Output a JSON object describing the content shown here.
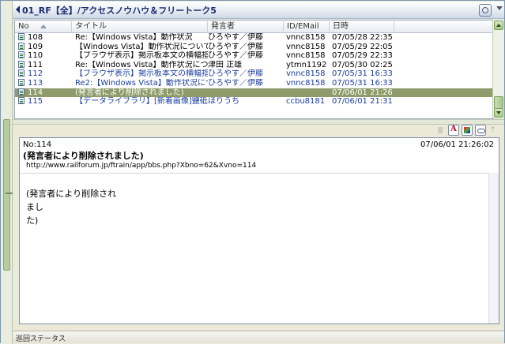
{
  "window": {
    "title": "01_RF【全】/アクセスノウハウ＆フリートーク5"
  },
  "list": {
    "columns": [
      "No",
      "タイトル",
      "発言者",
      "ID/EMail",
      "日時"
    ],
    "rows": [
      {
        "no": "108",
        "title": "Re:【Windows Vista】動作状況",
        "poster": "ひろやす／伊藤",
        "id": "vnnc8158",
        "date": "07/05/28 22:35...",
        "style": "normal"
      },
      {
        "no": "109",
        "title": "【Windows Vista】動作状況についての...",
        "poster": "ひろやす／伊藤",
        "id": "vnnc8158",
        "date": "07/05/29 22:05...",
        "style": "normal"
      },
      {
        "no": "110",
        "title": "【ブラウザ表示】掲示板本文の横幅指...",
        "poster": "ひろやす／伊藤",
        "id": "vnnc8158",
        "date": "07/05/29 22:33...",
        "style": "normal"
      },
      {
        "no": "111",
        "title": "Re:【Windows Vista】動作状況につい...",
        "poster": "津田 正雄",
        "id": "ytmn1192",
        "date": "07/05/30 02:25...",
        "style": "normal"
      },
      {
        "no": "112",
        "title": "【ブラウザ表示】掲示板本文の横幅指...",
        "poster": "ひろやす／伊藤",
        "id": "vnnc8158",
        "date": "07/05/31 16:33...",
        "style": "blue"
      },
      {
        "no": "113",
        "title": "Re2:【Windows Vista】動作状況につ...",
        "poster": "ひろやす／伊藤",
        "id": "vnnc8158",
        "date": "07/05/31 16:33...",
        "style": "blue"
      },
      {
        "no": "114",
        "title": "(発言者により削除されました)",
        "poster": "",
        "id": "",
        "date": "07/06/01 21:26...",
        "style": "selected"
      },
      {
        "no": "115",
        "title": "【データライブラリ】[新着画像]鹽砥6...",
        "poster": "ほりうち",
        "id": "ccbu8181",
        "date": "07/06/01 21:31...",
        "style": "blue"
      }
    ]
  },
  "message": {
    "no": "No:114",
    "date": "07/06/01 21:26:02",
    "subject": "(発言者により削除されました)",
    "url": "http://www.railforum.jp/ftrain/app/bbs.php?Xbno=62&Xvno=114",
    "body_line1": "(発言者により削除されまし",
    "body_line2": "た)"
  },
  "status": {
    "text": "巡回ステータス"
  },
  "colors": {
    "selected_row": "#8f9b6a",
    "blue_row": "#1a3d9e",
    "title_text": "#1e2d6b"
  },
  "icons": [
    "back-arrow-icon",
    "clock-icon",
    "document-icon",
    "font-color-icon",
    "color-palette-icon",
    "link-icon",
    "scroll-up-icon",
    "scroll-down-icon"
  ]
}
